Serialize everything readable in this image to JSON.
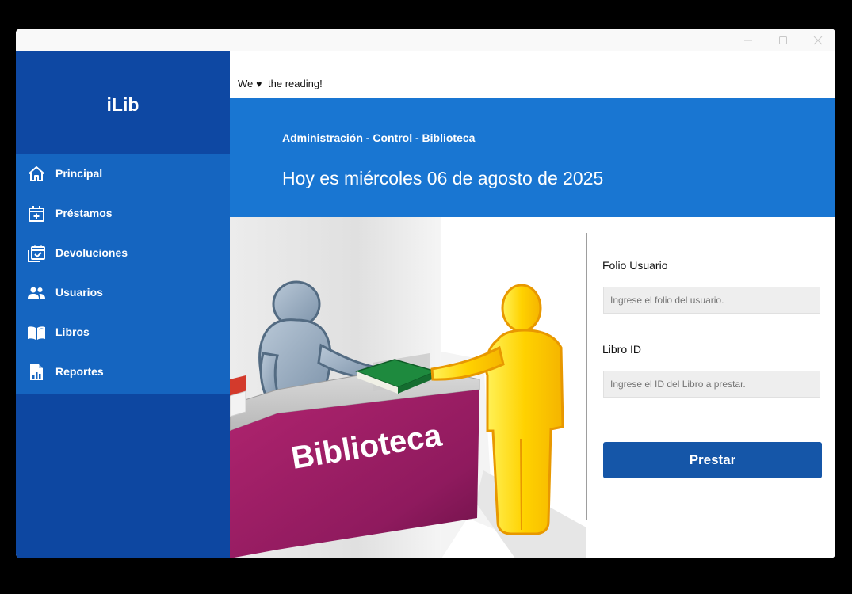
{
  "window": {
    "controls": [
      "minimize",
      "maximize",
      "close"
    ]
  },
  "sidebar": {
    "brand": "iLib",
    "items": [
      {
        "label": "Principal",
        "icon": "home-icon"
      },
      {
        "label": "Préstamos",
        "icon": "calendar-add-icon"
      },
      {
        "label": "Devoluciones",
        "icon": "calendar-check-icon"
      },
      {
        "label": "Usuarios",
        "icon": "users-icon"
      },
      {
        "label": "Libros",
        "icon": "book-open-icon"
      },
      {
        "label": "Reportes",
        "icon": "report-icon"
      }
    ]
  },
  "header": {
    "tagline_before": "We",
    "tagline_after": "the reading!",
    "subtitle": "Administración - Control - Biblioteca",
    "date": "Hoy es miércoles 06 de agosto de 2025"
  },
  "illustration": {
    "desk_text": "Biblioteca"
  },
  "form": {
    "folio_label": "Folio Usuario",
    "folio_placeholder": "Ingrese el folio del usuario.",
    "folio_value": "",
    "libro_label": "Libro ID",
    "libro_placeholder": "Ingrese el ID del Libro a prestar.",
    "libro_value": "",
    "submit_label": "Prestar"
  },
  "colors": {
    "sidebar_dark": "#0d47a1",
    "sidebar_menu": "#1565c0",
    "banner": "#1976d2",
    "button": "#1556a8",
    "desk": "#9c1c68",
    "figure_yellow": "#ffd400",
    "figure_gray": "#8fa3b8"
  }
}
